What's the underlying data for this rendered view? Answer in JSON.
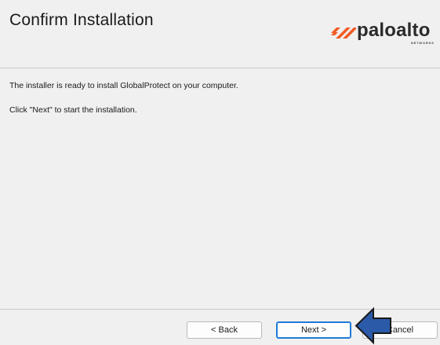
{
  "window": {
    "title": "Confirm Installation"
  },
  "logo": {
    "brand": "paloalto",
    "sub": "NETWORKS",
    "accent_color": "#f15a24"
  },
  "body": {
    "message_ready": "The installer is ready to install GlobalProtect on your computer.",
    "message_next": "Click \"Next\" to start the installation."
  },
  "buttons": {
    "back": "< Back",
    "next": "Next >",
    "cancel": "Cancel"
  },
  "annotation": {
    "arrow_color": "#2b5aa8",
    "direction": "left",
    "points_to": "next-button"
  }
}
